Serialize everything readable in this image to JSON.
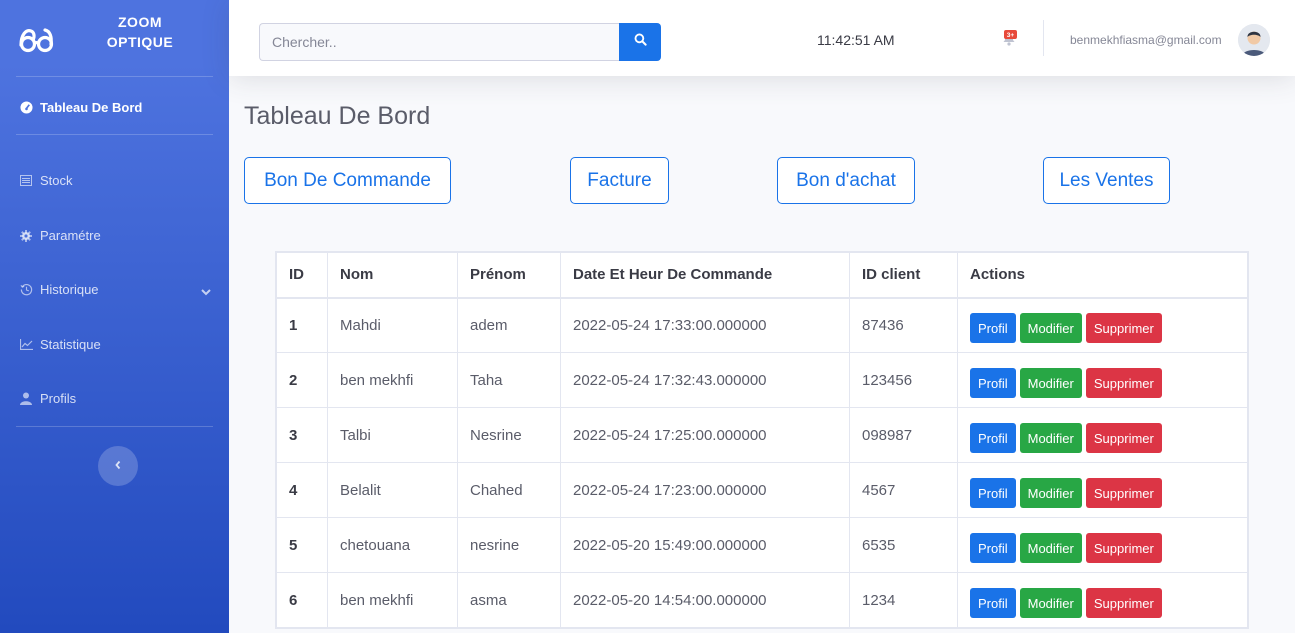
{
  "brand": {
    "line1": "ZOOM",
    "line2": "OPTIQUE"
  },
  "sidebar": {
    "items": [
      {
        "label": "Tableau De Bord",
        "icon": "dashboard-icon",
        "active": true
      },
      {
        "label": "Stock",
        "icon": "list-icon"
      },
      {
        "label": "Paramétre",
        "icon": "gear-icon"
      },
      {
        "label": "Historique",
        "icon": "history-icon",
        "expandable": true
      },
      {
        "label": "Statistique",
        "icon": "chart-icon"
      },
      {
        "label": "Profils",
        "icon": "user-icon"
      }
    ]
  },
  "topbar": {
    "search_placeholder": "Chercher..",
    "clock": "11:42:51 AM",
    "alert_badge": "3+",
    "user_email": "benmekhfiasma@gmail.com"
  },
  "page": {
    "title": "Tableau De Bord",
    "buttons": [
      "Bon De Commande",
      "Facture",
      "Bon d'achat",
      "Les Ventes"
    ]
  },
  "table": {
    "headers": [
      "ID",
      "Nom",
      "Prénom",
      "Date Et Heur De Commande",
      "ID client",
      "Actions"
    ],
    "rows": [
      {
        "id": "1",
        "nom": "Mahdi",
        "prenom": "adem",
        "date": "2022-05-24 17:33:00.000000",
        "client": "87436"
      },
      {
        "id": "2",
        "nom": "ben mekhfi",
        "prenom": "Taha",
        "date": "2022-05-24 17:32:43.000000",
        "client": "123456"
      },
      {
        "id": "3",
        "nom": "Talbi",
        "prenom": "Nesrine",
        "date": "2022-05-24 17:25:00.000000",
        "client": "098987"
      },
      {
        "id": "4",
        "nom": "Belalit",
        "prenom": "Chahed",
        "date": "2022-05-24 17:23:00.000000",
        "client": "4567"
      },
      {
        "id": "5",
        "nom": "chetouana",
        "prenom": "nesrine",
        "date": "2022-05-20 15:49:00.000000",
        "client": "6535"
      },
      {
        "id": "6",
        "nom": "ben mekhfi",
        "prenom": "asma",
        "date": "2022-05-20 14:54:00.000000",
        "client": "1234"
      }
    ],
    "action_labels": {
      "profil": "Profil",
      "modifier": "Modifier",
      "supprimer": "Supprimer"
    }
  },
  "colors": {
    "primary": "#1a73e8",
    "success": "#28a745",
    "danger": "#dc3545",
    "sidebar_top": "#4e73df",
    "sidebar_bottom": "#224abe"
  }
}
